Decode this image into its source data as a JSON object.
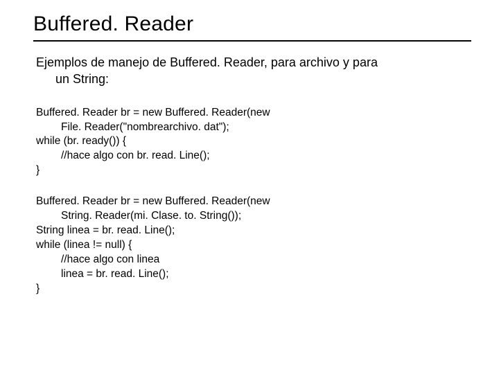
{
  "title": "Buffered. Reader",
  "subtitle_line1": "Ejemplos de manejo de Buffered. Reader, para archivo y para",
  "subtitle_line2": "un String:",
  "code1": {
    "l1": "Buffered. Reader br = new Buffered. Reader(new",
    "l2": "File. Reader(\"nombrearchivo. dat\");",
    "l3": "while (br. ready()) {",
    "l4": "//hace algo con br. read. Line();",
    "l5": "}"
  },
  "code2": {
    "l1": "Buffered. Reader br = new Buffered. Reader(new",
    "l2": "String. Reader(mi. Clase. to. String());",
    "l3": "String linea = br. read. Line();",
    "l4": "while (linea != null) {",
    "l5": "//hace algo con linea",
    "l6": "linea = br. read. Line();",
    "l7": "}"
  }
}
